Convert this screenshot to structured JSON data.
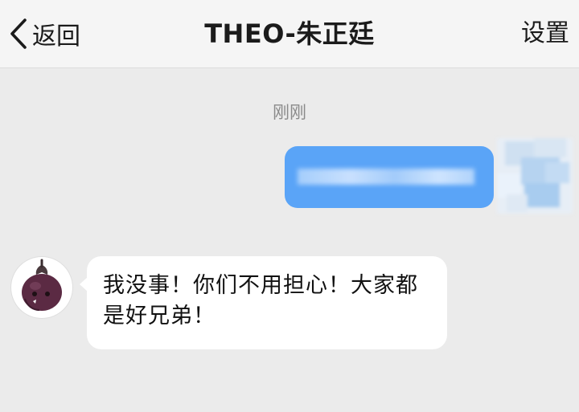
{
  "nav": {
    "back_icon": "chevron-left-icon",
    "back_label": "返回",
    "title": "THEO-朱正廷",
    "settings_label": "设置"
  },
  "chat": {
    "timestamp": "刚刚",
    "messages": [
      {
        "direction": "sent",
        "text": "",
        "redacted": true,
        "avatar": "blurred-avatar"
      },
      {
        "direction": "received",
        "text": "我没事！你们不用担心！大家都是好兄弟！",
        "avatar": "mangosteen-avatar"
      }
    ]
  },
  "colors": {
    "background": "#ebebeb",
    "nav_background": "#f5f5f5",
    "sent_bubble": "#5aa4f7",
    "received_bubble": "#ffffff",
    "avatar_fruit": "#5b2a43"
  }
}
